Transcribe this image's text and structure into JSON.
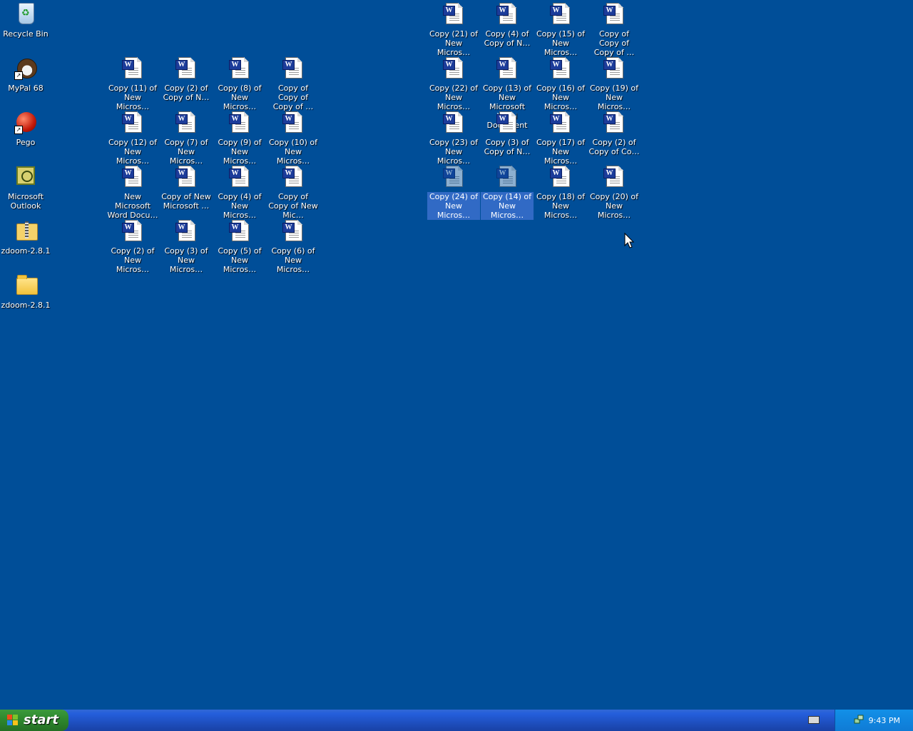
{
  "desktop": {
    "system_icons": [
      {
        "label": "Recycle Bin",
        "icon": "recycle-bin-icon"
      },
      {
        "label": "MyPal 68",
        "icon": "mypal-icon"
      },
      {
        "label": "Pego",
        "icon": "pego-icon"
      },
      {
        "label": "Microsoft Outlook",
        "icon": "outlook-icon"
      },
      {
        "label": "zdoom-2.8.1",
        "icon": "zip-folder-icon"
      },
      {
        "label": "zdoom-2.8.1",
        "icon": "folder-icon"
      }
    ],
    "docs_left": [
      "Copy (11) of New Micros…",
      "Copy (2) of Copy of N…",
      "Copy (8) of New Micros…",
      "Copy of Copy of Copy of …",
      "Copy (12) of New Micros…",
      "Copy (7) of New Micros…",
      "Copy (9) of New Micros…",
      "Copy (10) of New Micros…",
      "New Microsoft Word Docu…",
      "Copy of New Microsoft …",
      "Copy (4) of New Micros…",
      "Copy of Copy of New Mic…",
      "Copy (2) of New Micros…",
      "Copy (3) of New Micros…",
      "Copy (5) of New Micros…",
      "Copy (6) of New Micros…"
    ],
    "docs_right": [
      "Copy (21) of New Micros…",
      "Copy (4) of Copy of N…",
      "Copy (15) of New Micros…",
      "Copy of Copy of Copy of …",
      "Copy (22) of New Micros…",
      "Copy (13) of New Microsoft Word Document",
      "Copy (16) of New Micros…",
      "Copy (19) of New Micros…",
      "Copy (23) of New Micros…",
      "Copy (3) of Copy of N…",
      "Copy (17) of New Micros…",
      "Copy (2) of Copy of Co…",
      "Copy (24) of New Micros…",
      "Copy (14) of New Micros…",
      "Copy (18) of New Micros…",
      "Copy (20) of New Micros…"
    ],
    "selected_right": [
      12,
      13
    ]
  },
  "taskbar": {
    "start_label": "start",
    "clock": "9:43 PM"
  },
  "colors": {
    "desktop_bg": "#004e98",
    "selection": "#316ac5",
    "taskbar": "#245edb",
    "start_button": "#2f8a2f"
  }
}
